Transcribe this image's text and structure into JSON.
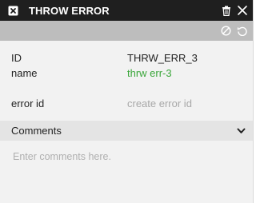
{
  "titlebar": {
    "title": "THROW ERROR",
    "icon": "close-box-icon",
    "delete_icon": "trash-icon",
    "close_icon": "close-icon"
  },
  "toolbar": {
    "disable_icon": "disable-icon",
    "revert_icon": "revert-icon"
  },
  "properties": [
    {
      "label": "ID",
      "value": "THRW_ERR_3"
    },
    {
      "label": "name",
      "value": "thrw err-3",
      "value_color": "#3aa63a"
    },
    {
      "label": "error id",
      "placeholder": "create error id"
    }
  ],
  "comments": {
    "header": "Comments",
    "toggle_icon": "chevron-down-icon",
    "placeholder": "Enter comments here."
  }
}
